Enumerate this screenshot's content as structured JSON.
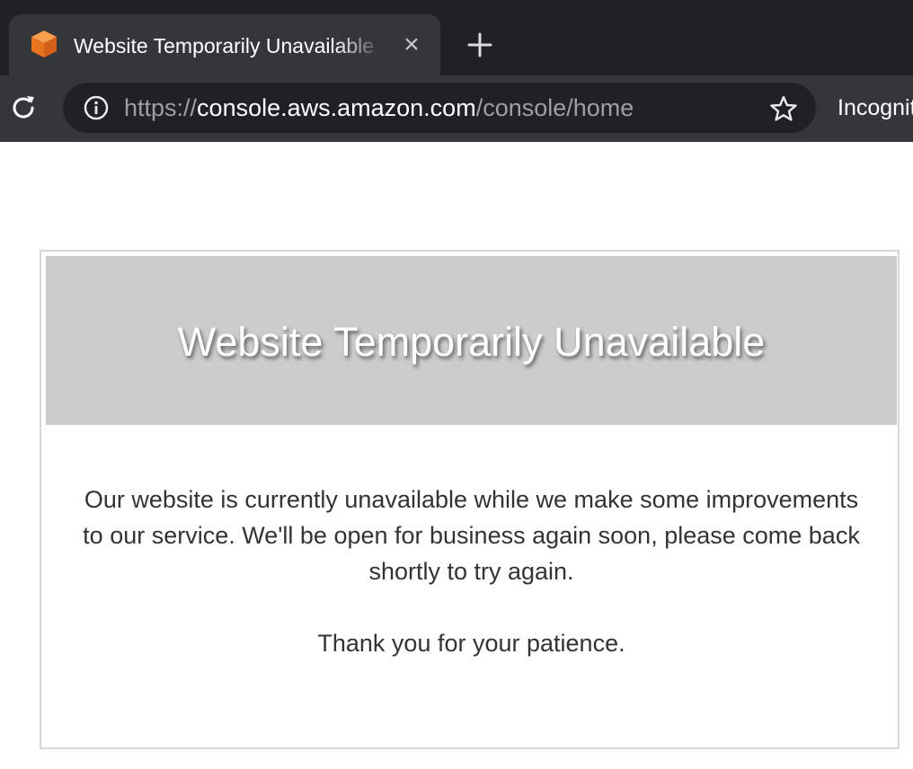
{
  "browser": {
    "tab": {
      "title": "Website Temporarily Unavailable",
      "favicon": "orange-cube-icon",
      "close_label": "×"
    },
    "new_tab": "plus-icon",
    "address_bar": {
      "scheme": "https://",
      "host": "console.aws.amazon.com",
      "path": "/console/home"
    },
    "incognito_label": "Incognito",
    "icons": {
      "reload": "reload-icon",
      "info": "info-icon",
      "bookmark": "star-icon"
    }
  },
  "page": {
    "header_title": "Website Temporarily Unavailable",
    "message": "Our website is currently unavailable while we make some improvements to our service. We'll be open for business again soon, please come back shortly to try again.",
    "thanks": "Thank you for your patience."
  },
  "colors": {
    "chrome_dark": "#202124",
    "chrome_toolbar": "#35363a",
    "header_gray": "#cccccc",
    "body_text": "#333333",
    "favicon_orange": "#f08a24"
  }
}
